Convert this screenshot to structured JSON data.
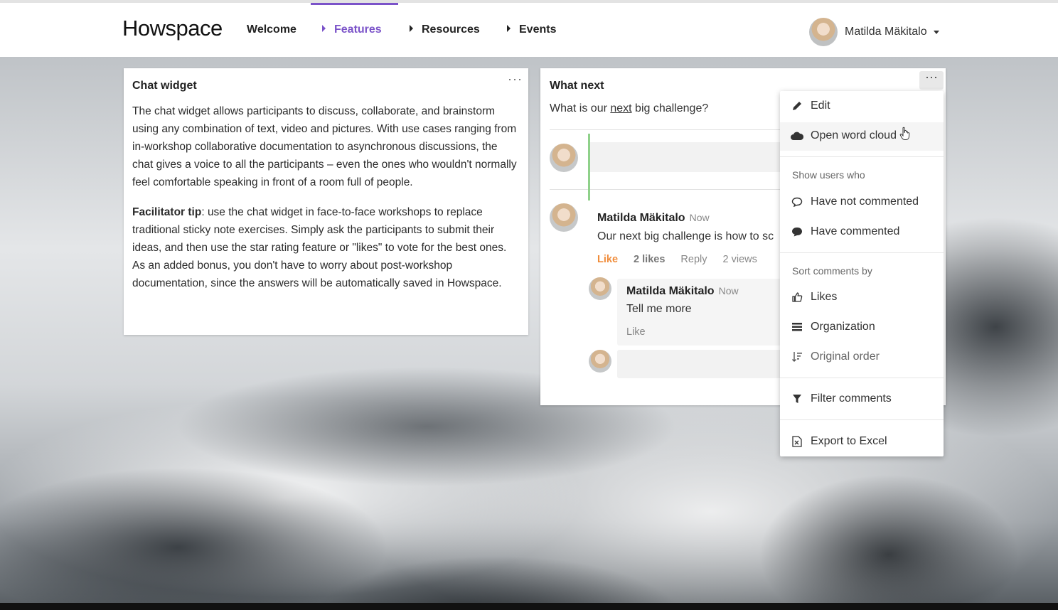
{
  "app": {
    "logo": "Howspace"
  },
  "nav": {
    "items": [
      {
        "label": "Welcome"
      },
      {
        "label": "Features"
      },
      {
        "label": "Resources"
      },
      {
        "label": "Events"
      }
    ],
    "active": "Features",
    "accent": "#7b53c9"
  },
  "user": {
    "name": "Matilda Mäkitalo"
  },
  "chat_widget": {
    "title": "Chat widget",
    "menu_glyph": "···",
    "paragraph1": "The chat widget allows participants to discuss, collaborate, and brainstorm using any combination of text, video and pictures. With use cases ranging from in-workshop collaborative documentation to asynchronous discussions, the chat gives a voice to all the participants – even the ones who wouldn't normally feel comfortable speaking in front of a room full of people.",
    "tip_label": "Facilitator tip",
    "tip_text": ": use the chat widget in face-to-face workshops to replace traditional sticky note exercises. Simply ask the participants to submit their ideas, and then use the star rating feature or \"likes\" to vote for the best ones. As an added bonus, you don't have to worry about post-workshop documentation, since the answers will be automatically saved in Howspace."
  },
  "what_next": {
    "title": "What next",
    "menu_glyph": "···",
    "question_before": "What is our ",
    "question_underlined": "next",
    "question_after": " big challenge?",
    "comment": {
      "author": "Matilda Mäkitalo",
      "time": "Now",
      "text": "Our next big challenge is how to sc",
      "like_label": "Like",
      "likes": "2 likes",
      "reply_label": "Reply",
      "views": "2 views",
      "accent": "#f08c3a"
    },
    "reply": {
      "author": "Matilda Mäkitalo",
      "time": "Now",
      "text": "Tell me more",
      "like_label": "Like"
    }
  },
  "menu": {
    "edit": "Edit",
    "open_word_cloud": "Open word cloud",
    "show_users_header": "Show users who",
    "have_not_commented": "Have not commented",
    "have_commented": "Have commented",
    "sort_header": "Sort comments by",
    "sort_likes": "Likes",
    "sort_organization": "Organization",
    "sort_original": "Original order",
    "filter": "Filter comments",
    "export": "Export to Excel"
  }
}
